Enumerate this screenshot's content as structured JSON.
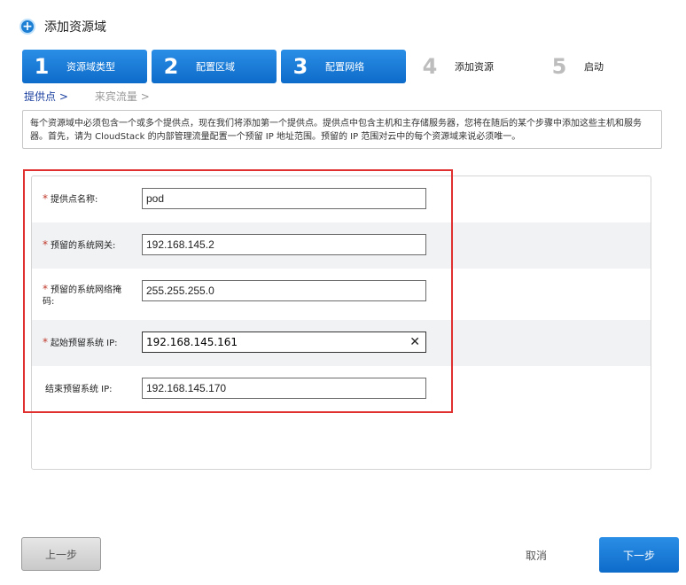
{
  "header": {
    "title": "添加资源域",
    "icon": "plus-circle-icon"
  },
  "steps": [
    {
      "num": "1",
      "label": "资源域类型",
      "state": "active"
    },
    {
      "num": "2",
      "label": "配置区域",
      "state": "active"
    },
    {
      "num": "3",
      "label": "配置网络",
      "state": "active"
    },
    {
      "num": "4",
      "label": "添加资源",
      "state": "inactive"
    },
    {
      "num": "5",
      "label": "启动",
      "state": "inactive"
    }
  ],
  "breadcrumb": {
    "active": "提供点 >",
    "inactive": "来宾流量 >"
  },
  "info_text": "每个资源域中必须包含一个或多个提供点，现在我们将添加第一个提供点。提供点中包含主机和主存储服务器，您将在随后的某个步骤中添加这些主机和服务器。首先，请为 CloudStack 的内部管理流量配置一个预留 IP 地址范围。预留的 IP 范围对云中的每个资源域来说必须唯一。",
  "form": {
    "fields": [
      {
        "label": "提供点名称:",
        "value": "pod",
        "required": "*"
      },
      {
        "label": "预留的系统网关:",
        "value": "192.168.145.2",
        "required": "*"
      },
      {
        "label": "预留的系统网络掩码:",
        "value": "255.255.255.0",
        "required": "*"
      },
      {
        "label": "起始预留系统 IP:",
        "value": "192.168.145.161",
        "required": "*"
      },
      {
        "label": "结束预留系统 IP:",
        "value": "192.168.145.170",
        "required": ""
      }
    ]
  },
  "buttons": {
    "prev": "上一步",
    "cancel": "取消",
    "next": "下一步"
  },
  "colors": {
    "accent": "#1d7fd4",
    "highlight_frame": "#e03030"
  }
}
